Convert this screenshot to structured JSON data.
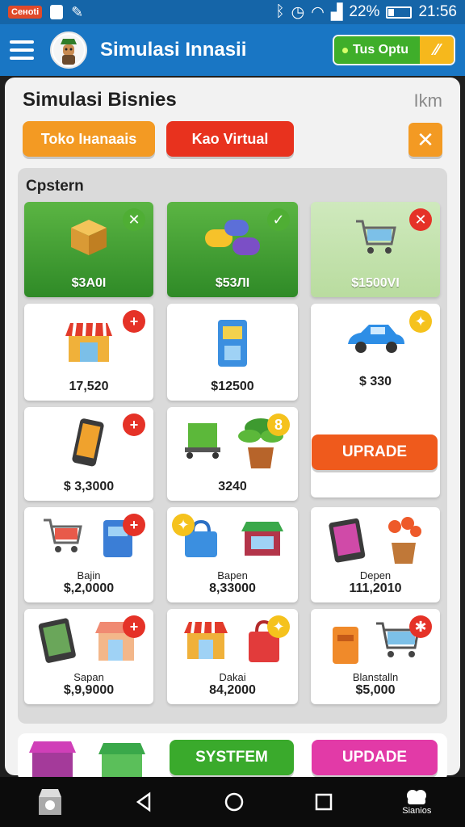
{
  "status_bar": {
    "carrier": "Cеноti",
    "battery": "22%",
    "time": "21:56"
  },
  "app_bar": {
    "title": "Simulasi Innasii",
    "option_button": "Tus Optu"
  },
  "panel": {
    "title": "Simulasi Bisnies",
    "right_text": "Ikm",
    "tabs": [
      "Toko Iнanaais",
      "Kao Virtual"
    ],
    "section_title": "Cpstern"
  },
  "cards": {
    "c1": {
      "value": "$3A0I",
      "badge": "✕"
    },
    "c2": {
      "value": "$53ЛI",
      "badge": "✓"
    },
    "c3": {
      "value": "$1500VI",
      "badge": "✕"
    },
    "c4": {
      "value": "17,520",
      "badge": "+"
    },
    "c5": {
      "value": "$12500"
    },
    "c6": {
      "value": "$ 330"
    },
    "c7": {
      "value": "$ 3,3000",
      "badge": "+"
    },
    "c8": {
      "value": "3240",
      "badge": "8"
    },
    "c9": {
      "name": "Bajin",
      "value": "$,2,0000",
      "badge": "+"
    },
    "c10": {
      "name": "Bapen",
      "value": "8,33000"
    },
    "c11": {
      "name": "Depen",
      "value": "111,2010"
    },
    "c12": {
      "name": "Sapan",
      "value": "$,9,9000",
      "badge": "+"
    },
    "c13": {
      "name": "Dakai",
      "value": "84,2000"
    },
    "c14": {
      "name": "Blanstalln",
      "value": "$5,000",
      "badge": "✱"
    }
  },
  "buttons": {
    "upgrade_mid": "UPRADE",
    "system": "SYSTFEM",
    "upgrade_bottom": "UPDADE"
  },
  "navbar": {
    "profile_label": "Sianios"
  },
  "colors": {
    "app_bar": "#1976c4",
    "status_bar": "#1565a8",
    "tab_orange": "#f39a23",
    "tab_red": "#e8321e",
    "card_green": "#3e9a30",
    "upgrade_orange": "#ef5a1c",
    "system_green": "#3aaa2c",
    "upgrade_pink": "#e23aa7"
  }
}
